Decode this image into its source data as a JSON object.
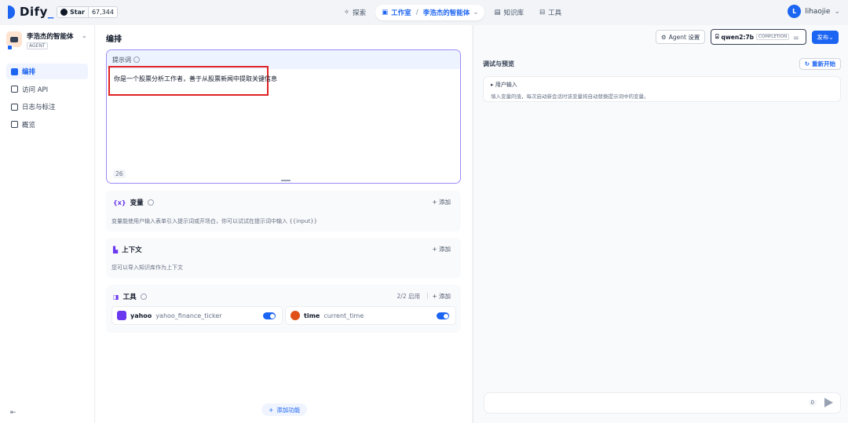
{
  "topbar": {
    "logo_text": "Dify",
    "github_star_label": "Star",
    "github_star_count": "67,344",
    "nav": {
      "explore": "探索",
      "studio": "工作室",
      "current_app": "李浩杰的智能体",
      "knowledge": "知识库",
      "tools": "工具"
    },
    "user": {
      "initial": "L",
      "name": "lihaojie"
    }
  },
  "sidebar": {
    "app_name": "李浩杰的智能体",
    "app_type": "AGENT",
    "items": [
      {
        "label": "编排",
        "active": true
      },
      {
        "label": "访问 API"
      },
      {
        "label": "日志与标注"
      },
      {
        "label": "概览"
      }
    ]
  },
  "main": {
    "title": "编排",
    "prompt": {
      "label": "提示词",
      "text": "你是一个股票分析工作者，善于从股票新闻中提取关键信息",
      "char_count": "26"
    },
    "variables": {
      "title": "变量",
      "add_label": "+ 添加",
      "description": "变量能使用户输入表单引入提示词或开场白，你可以试试在提示词中输入 {{input}}"
    },
    "context": {
      "title": "上下文",
      "add_label": "+ 添加",
      "description": "您可以导入知识库作为上下文"
    },
    "tools": {
      "title": "工具",
      "usage": "2/2 启用",
      "add_label": "+ 添加",
      "items": [
        {
          "name": "yahoo",
          "id": "yahoo_finance_ticker",
          "enabled": true,
          "color": "#6938ef"
        },
        {
          "name": "time",
          "id": "current_time",
          "enabled": true,
          "color": "#e04f16"
        }
      ]
    },
    "add_feature": "添加功能"
  },
  "header_controls": {
    "agent_settings": "Agent 设置",
    "model_name": "qwen2:7b",
    "model_mode": "COMPLETION",
    "publish": "发布"
  },
  "debug": {
    "title": "调试与预览",
    "restart": "重新开始",
    "user_input_title": "用户输入",
    "user_input_desc": "填入变量的值，每次启动新会话时该变量将自动替换提示词中的变量。",
    "char_count": "0"
  },
  "colors": {
    "primary": "#1c64f2",
    "highlight_box": "#e02424",
    "prompt_border": "#9b8afb"
  }
}
